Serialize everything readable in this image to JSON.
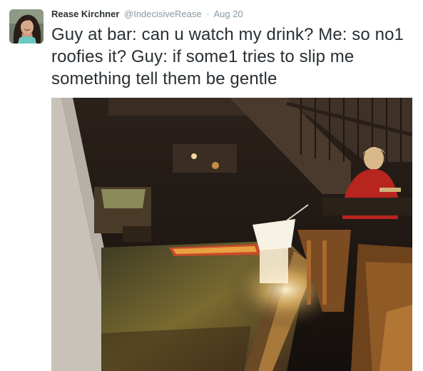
{
  "tweet": {
    "author_name": "Rease Kirchner",
    "handle": "@IndecisiveRease",
    "separator": "·",
    "timestamp": "Aug 20",
    "text": "Guy at bar: can u watch my drink? Me: so no1 roofies it? Guy: if some1 tries to slip me something tell them be gentle"
  },
  "icons": {
    "avatar": "user-avatar-photo",
    "media": "bar-photo"
  },
  "colors": {
    "text": "#292f33",
    "meta": "#8899a6",
    "background": "#ffffff"
  }
}
